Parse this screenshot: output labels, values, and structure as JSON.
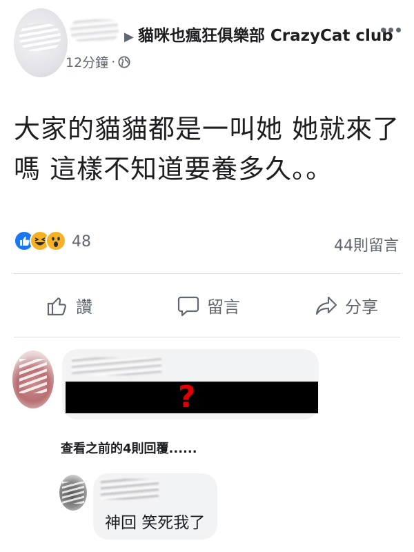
{
  "header": {
    "group_name": "貓咪也瘋狂俱樂部 CrazyCat club",
    "arrow_icon": "▶",
    "timestamp": "12分鐘",
    "separator": "·",
    "audience_icon": "globe-icon",
    "more_icon": "more-horizontal-icon"
  },
  "post": {
    "text_line1": "大家的貓貓都是一叫她 她就來了",
    "text_line2": "嗎 這樣不知道要養多久。。"
  },
  "stats": {
    "reaction_icons": [
      "like-icon",
      "haha-icon",
      "wow-icon"
    ],
    "reaction_count": "48",
    "comment_count": "44則留言"
  },
  "actions": {
    "like_label": "讚",
    "comment_label": "留言",
    "share_label": "分享"
  },
  "comments": {
    "first": {
      "hidden_mark": "?"
    },
    "view_previous": "查看之前的4則回覆......",
    "reply": {
      "text": "神回 笑死我了"
    }
  },
  "colors": {
    "text": "#1c1e21",
    "secondary": "#606770",
    "like_blue": "#1877f2",
    "reaction_yellow": "#f7b125",
    "bubble": "#f2f3f5",
    "divider": "#dadde1",
    "mark_red": "#e00000"
  }
}
